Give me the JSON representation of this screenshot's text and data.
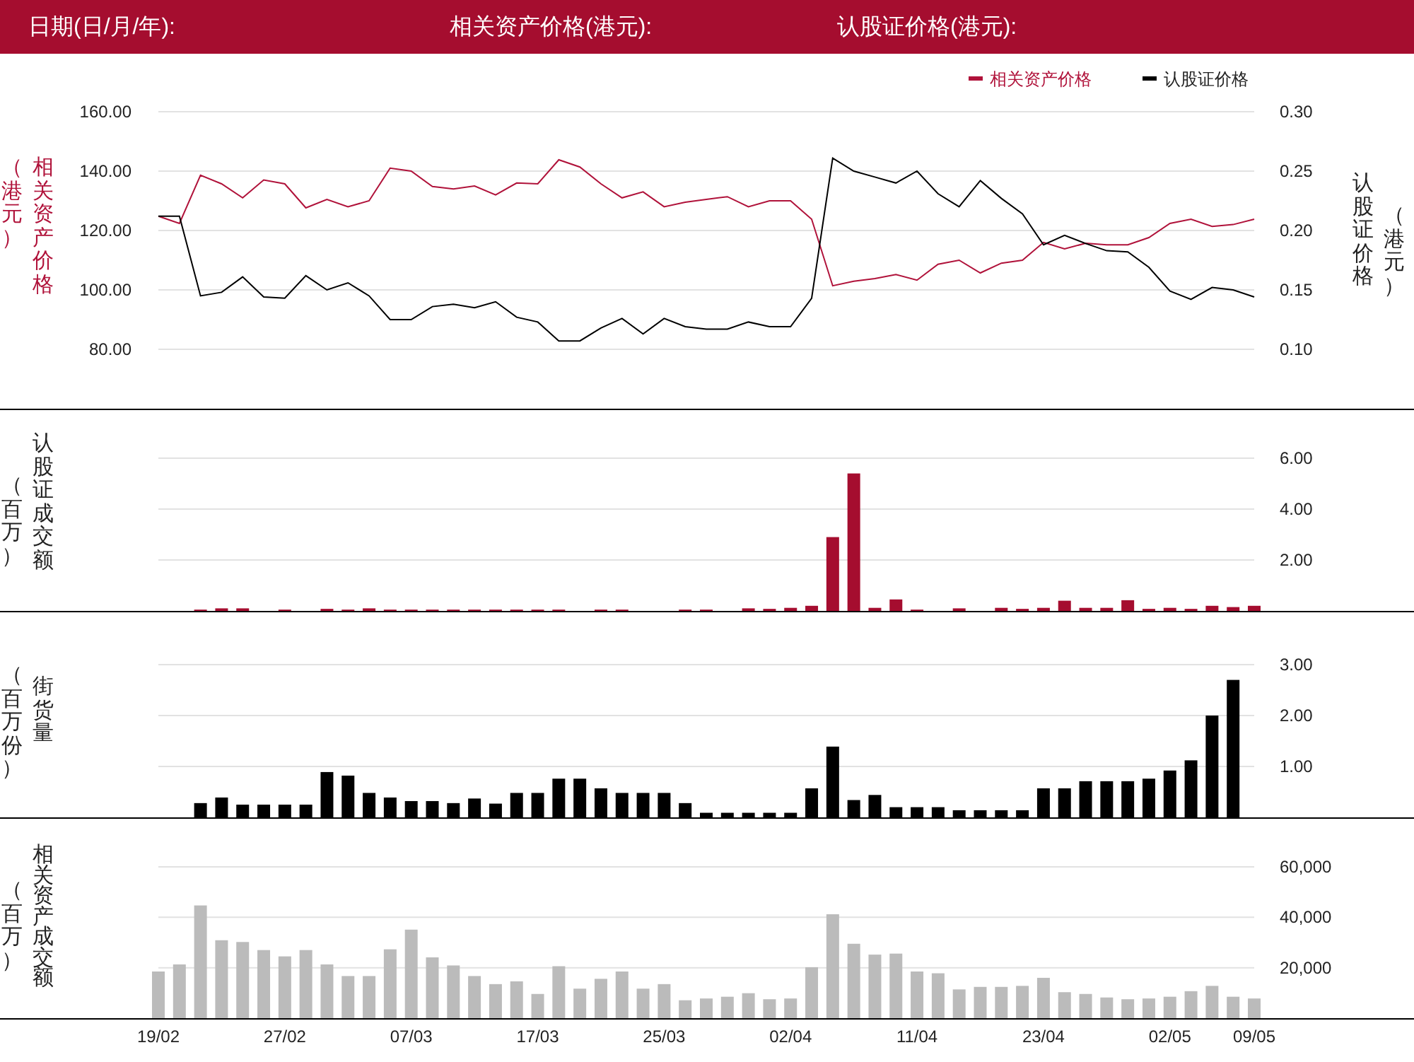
{
  "header": {
    "labels": [
      "日期(日/月/年):",
      "相关资产价格(港元):",
      "认股证价格(港元):"
    ]
  },
  "price_panel": {
    "left_axis_unit": "（港元）",
    "left_axis_title": "相关资产价格",
    "right_axis_title": "认股证价格",
    "right_axis_unit": "（港元）",
    "chart_data": {
      "type": "line",
      "categories": [
        null,
        null,
        null,
        null,
        null,
        null,
        null,
        null,
        null,
        null,
        null,
        null,
        null,
        null,
        null,
        null,
        null,
        null,
        null,
        null,
        null,
        null,
        null,
        null,
        null,
        null,
        null,
        null,
        null,
        null,
        null,
        null,
        null,
        null,
        null,
        null,
        null,
        null,
        null,
        null,
        null,
        null,
        null,
        null,
        null,
        null,
        null,
        null,
        null,
        null,
        null,
        null,
        null
      ],
      "series": [
        {
          "name": "相关资产价格",
          "color": "#b0123a",
          "values": [
            124.8,
            122.4,
            138.6,
            135.7,
            131,
            137,
            135.7,
            127.6,
            130.5,
            128,
            130,
            141,
            140,
            134.8,
            134,
            135,
            132,
            136,
            135.7,
            143.8,
            141.4,
            135.7,
            131,
            133,
            128,
            129.5,
            130.5,
            131.4,
            128,
            130,
            130,
            123.8,
            101.4,
            102.9,
            103.8,
            105.2,
            103.3,
            108.6,
            110,
            105.7,
            109,
            110,
            116,
            113.8,
            115.7,
            115.2,
            115.2,
            117.6,
            122.4,
            123.8,
            121.4,
            122,
            123.8
          ]
        },
        {
          "name": "认股证价格",
          "color": "#000000",
          "axis": "y2",
          "values": [
            0.212,
            0.212,
            0.145,
            0.148,
            0.161,
            0.144,
            0.143,
            0.162,
            0.15,
            0.156,
            0.145,
            0.125,
            0.125,
            0.136,
            0.138,
            0.135,
            0.14,
            0.127,
            0.123,
            0.107,
            0.107,
            0.118,
            0.126,
            0.113,
            0.126,
            0.119,
            0.117,
            0.117,
            0.123,
            0.119,
            0.119,
            0.143,
            0.261,
            0.25,
            0.245,
            0.24,
            0.25,
            0.231,
            0.22,
            0.242,
            0.227,
            0.214,
            0.188,
            0.196,
            0.189,
            0.183,
            0.182,
            0.169,
            0.149,
            0.142,
            0.152,
            0.15,
            0.144
          ]
        }
      ],
      "grid": true,
      "legend": true,
      "ylim": [
        80,
        160
      ],
      "yticks": [
        {
          "value": 80,
          "label": "80.00"
        },
        {
          "value": 100,
          "label": "100.00"
        },
        {
          "value": 120,
          "label": "120.00"
        },
        {
          "value": 140,
          "label": "140.00"
        },
        {
          "value": 160,
          "label": "160.00"
        }
      ],
      "y2lim": [
        0.1,
        0.3
      ],
      "y2ticks": [
        {
          "value": 0.1,
          "label": "0.10"
        },
        {
          "value": 0.15,
          "label": "0.15"
        },
        {
          "value": 0.2,
          "label": "0.20"
        },
        {
          "value": 0.25,
          "label": "0.25"
        },
        {
          "value": 0.3,
          "label": "0.30"
        }
      ]
    }
  },
  "volume_panels": [
    {
      "axis_title": "认股证成交额",
      "axis_unit": "（百万）",
      "chart_data": {
        "type": "bar",
        "categories": [
          null,
          null,
          null,
          null,
          null,
          null,
          null,
          null,
          null,
          null,
          null,
          null,
          null,
          null,
          null,
          null,
          null,
          null,
          null,
          null,
          null,
          null,
          null,
          null,
          null,
          null,
          null,
          null,
          null,
          null,
          null,
          null,
          null,
          null,
          null,
          null,
          null,
          null,
          null,
          null,
          null,
          null,
          null,
          null,
          null,
          null,
          null,
          null,
          null,
          null,
          null,
          null,
          null
        ],
        "series": [
          {
            "color": "#a50d2f",
            "values": [
              null,
              null,
              0.05,
              0.1,
              0.1,
              null,
              0.05,
              null,
              0.08,
              0.05,
              0.1,
              0.05,
              0.05,
              0.05,
              0.05,
              0.05,
              0.05,
              0.05,
              0.05,
              0.05,
              null,
              0.05,
              0.05,
              null,
              null,
              0.05,
              0.05,
              null,
              0.1,
              0.08,
              0.12,
              0.2,
              2.9,
              5.4,
              0.12,
              0.45,
              0.05,
              null,
              0.1,
              null,
              0.12,
              0.08,
              0.12,
              0.4,
              0.12,
              0.12,
              0.42,
              0.08,
              0.12,
              0.08,
              0.2,
              0.15,
              0.2
            ]
          }
        ],
        "grid": true,
        "ylim": [
          0,
          6
        ],
        "yticks": [
          {
            "value": 2,
            "label": "2.00"
          },
          {
            "value": 4,
            "label": "4.00"
          },
          {
            "value": 6,
            "label": "6.00"
          }
        ]
      }
    },
    {
      "axis_title": "街货量",
      "axis_unit": "（百万份）",
      "chart_data": {
        "type": "bar",
        "categories": [
          null,
          null,
          null,
          null,
          null,
          null,
          null,
          null,
          null,
          null,
          null,
          null,
          null,
          null,
          null,
          null,
          null,
          null,
          null,
          null,
          null,
          null,
          null,
          null,
          null,
          null,
          null,
          null,
          null,
          null,
          null,
          null,
          null,
          null,
          null,
          null,
          null,
          null,
          null,
          null,
          null,
          null,
          null,
          null,
          null,
          null,
          null,
          null,
          null,
          null,
          null,
          null,
          null
        ],
        "series": [
          {
            "color": "#000000",
            "values": [
              null,
              null,
              0.28,
              0.39,
              0.25,
              0.25,
              0.25,
              0.25,
              0.89,
              0.82,
              0.48,
              0.39,
              0.32,
              0.32,
              0.28,
              0.37,
              0.27,
              0.48,
              0.48,
              0.76,
              0.76,
              0.57,
              0.48,
              0.48,
              0.48,
              0.28,
              0.09,
              0.09,
              0.09,
              0.09,
              0.09,
              0.57,
              1.39,
              0.34,
              0.44,
              0.2,
              0.2,
              0.2,
              0.14,
              0.14,
              0.14,
              0.14,
              0.57,
              0.57,
              0.71,
              0.71,
              0.71,
              0.76,
              0.92,
              1.12,
              2.0,
              2.7,
              null
            ]
          }
        ],
        "grid": true,
        "ylim": [
          0,
          3
        ],
        "yticks": [
          {
            "value": 1,
            "label": "1.00"
          },
          {
            "value": 2,
            "label": "2.00"
          },
          {
            "value": 3,
            "label": "3.00"
          }
        ]
      }
    },
    {
      "axis_title": "相关资产成交额",
      "axis_unit": "（百万）",
      "chart_data": {
        "type": "bar",
        "categories": [
          "19/02",
          null,
          null,
          null,
          null,
          null,
          "27/02",
          null,
          null,
          null,
          null,
          null,
          "07/03",
          null,
          null,
          null,
          null,
          null,
          "17/03",
          null,
          null,
          null,
          null,
          null,
          "25/03",
          null,
          null,
          null,
          null,
          null,
          "02/04",
          null,
          null,
          null,
          null,
          null,
          "11/04",
          null,
          null,
          null,
          null,
          null,
          "23/04",
          null,
          null,
          null,
          null,
          null,
          "02/05",
          null,
          null,
          null,
          "09/05"
        ],
        "series": [
          {
            "color": "#bbbbbb",
            "values": [
              18500,
              21300,
              44700,
              30900,
              30200,
              27000,
              24500,
              27000,
              21300,
              16700,
              16700,
              27300,
              35100,
              24100,
              20900,
              16700,
              13500,
              14600,
              9600,
              20600,
              11700,
              15600,
              18500,
              11700,
              13500,
              7100,
              7800,
              8500,
              9900,
              7500,
              7800,
              20200,
              41200,
              29500,
              25200,
              25600,
              18500,
              17800,
              11400,
              12400,
              12400,
              12800,
              16000,
              10300,
              9600,
              8200,
              7500,
              7800,
              8500,
              10700,
              12800,
              8500,
              7800
            ]
          }
        ],
        "grid": true,
        "ylim": [
          0,
          60000
        ],
        "yticks": [
          {
            "value": 20000,
            "label": "20,000"
          },
          {
            "value": 40000,
            "label": "40,000"
          },
          {
            "value": 60000,
            "label": "60,000"
          }
        ]
      }
    }
  ]
}
